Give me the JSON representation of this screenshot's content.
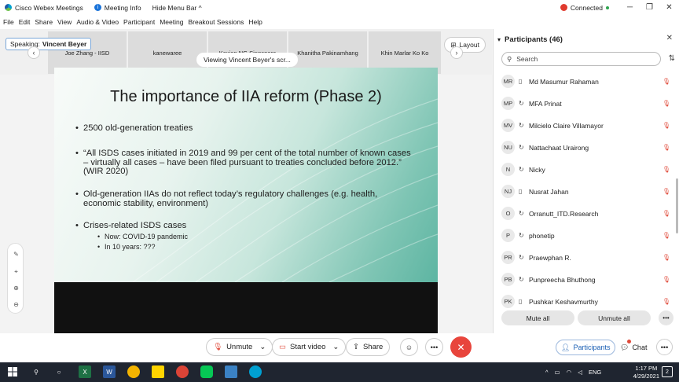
{
  "titlebar": {
    "app_title": "Cisco Webex Meetings",
    "meeting_info": "Meeting Info",
    "hide_menu": "Hide Menu Bar ^",
    "connected": "Connected",
    "minimize": "─",
    "restore": "❐",
    "close": "✕"
  },
  "menu": [
    "File",
    "Edit",
    "Share",
    "View",
    "Audio & Video",
    "Participant",
    "Meeting",
    "Breakout Sessions",
    "Help"
  ],
  "thumbs": {
    "speaking_label": "Speaking:",
    "speaking_name": "Vincent Beyer",
    "items": [
      "Joe Zhang - IISD",
      "kanewaree",
      "Kexian NG Singapore",
      "Khanitha Pakinamhang",
      "Khin Marlar Ko Ko"
    ],
    "layout_label": "Layout"
  },
  "share": {
    "viewing": "Viewing Vincent Beyer's scr..."
  },
  "slide": {
    "title": "The importance of IIA reform (Phase 2)",
    "bullets": [
      "2500 old-generation treaties",
      "“All ISDS cases initiated in 2019 and 99 per cent of the total number of known cases – virtually all cases – have been filed pursuant to treaties concluded before 2012.” (WIR 2020)",
      "Old-generation IIAs do not reflect today’s regulatory challenges (e.g. health, economic stability, environment)",
      "Crises-related ISDS cases"
    ],
    "sub_bullets": [
      "Now: COVID-19 pandemic",
      "In 10 years: ???"
    ]
  },
  "panel": {
    "title": "Participants (46)",
    "search_placeholder": "Search",
    "participants": [
      {
        "initials": "MR",
        "name": "Md Masumur Rahaman",
        "device": "phone"
      },
      {
        "initials": "MP",
        "name": "MFA Prinat",
        "device": "sync"
      },
      {
        "initials": "MV",
        "name": "Milcielo Claire Villamayor",
        "device": "sync"
      },
      {
        "initials": "NU",
        "name": "Nattachaat Urairong",
        "device": "sync"
      },
      {
        "initials": "N",
        "name": "Nicky",
        "device": "sync"
      },
      {
        "initials": "NJ",
        "name": "Nusrat Jahan",
        "device": "phone"
      },
      {
        "initials": "O",
        "name": "Orranutt_ITD.Research",
        "device": "sync"
      },
      {
        "initials": "P",
        "name": "phonetip",
        "device": "sync"
      },
      {
        "initials": "PR",
        "name": "Praewphan R.",
        "device": "sync"
      },
      {
        "initials": "PB",
        "name": "Punpreecha Bhuthong",
        "device": "sync"
      },
      {
        "initials": "PK",
        "name": "Pushkar Keshavmurthy",
        "device": "phone"
      }
    ],
    "mute_all": "Mute all",
    "unmute_all": "Unmute all"
  },
  "controls": {
    "unmute": "Unmute",
    "start_video": "Start video",
    "share": "Share",
    "participants": "Participants",
    "chat": "Chat"
  },
  "taskbar": {
    "lang": "ENG",
    "time": "1:17 PM",
    "date": "4/29/2021",
    "notifications": "2"
  },
  "colors": {
    "accent_blue": "#1a5fb4",
    "leave_red": "#e8453c",
    "muted_red": "#e04a3a",
    "taskbar": "#1f2530"
  }
}
